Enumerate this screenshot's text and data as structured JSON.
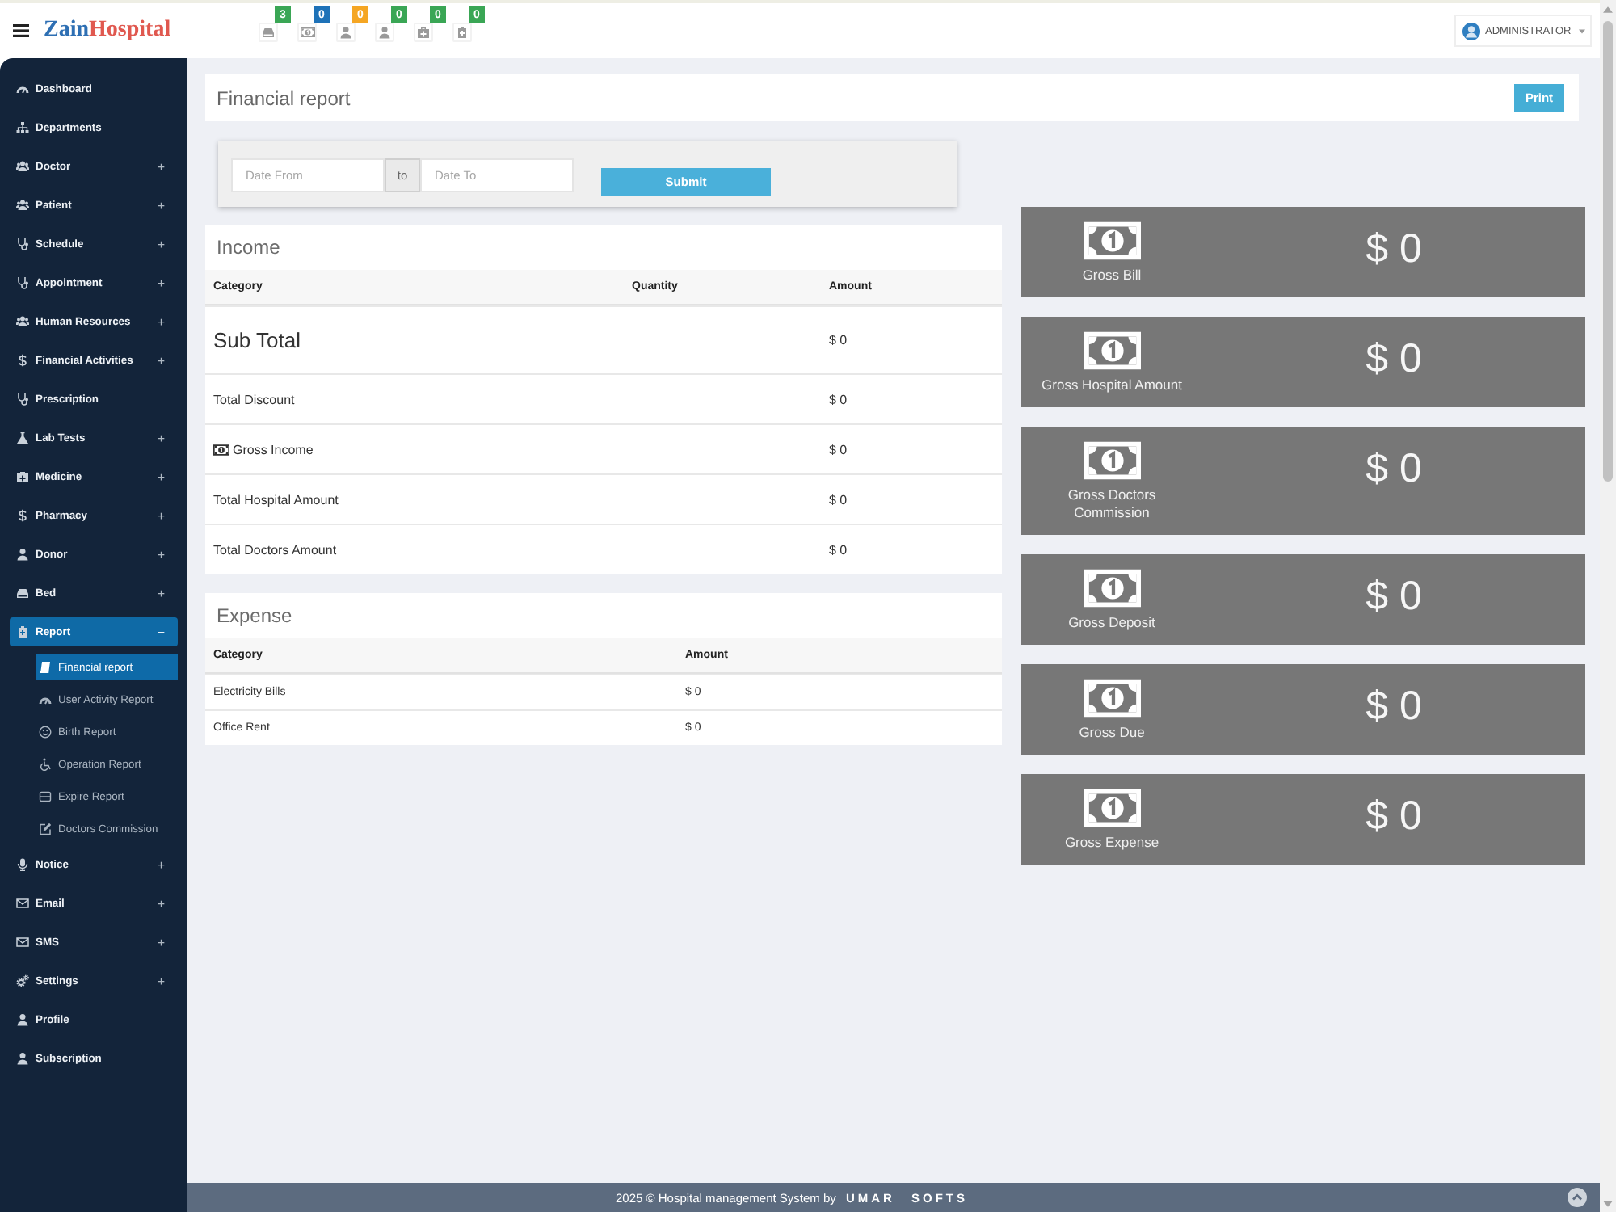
{
  "topbar": {
    "logo": {
      "first": "Zain",
      "second": "Hospital"
    },
    "notifications": [
      {
        "count": "3",
        "color": "#3aa655"
      },
      {
        "count": "0",
        "color": "#1e72b8"
      },
      {
        "count": "0",
        "color": "#f5a623"
      },
      {
        "count": "0",
        "color": "#3aa655"
      },
      {
        "count": "0",
        "color": "#3aa655"
      },
      {
        "count": "0",
        "color": "#3aa655"
      }
    ],
    "user_menu": {
      "label": "ADMINISTRATOR"
    }
  },
  "sidebar": {
    "items": [
      {
        "label": "Dashboard",
        "selected": false
      },
      {
        "label": "Departments",
        "selected": false
      },
      {
        "label": "Doctor",
        "toggle": "+",
        "selected": false
      },
      {
        "label": "Patient",
        "toggle": "+",
        "selected": false
      },
      {
        "label": "Schedule",
        "toggle": "+",
        "selected": false
      },
      {
        "label": "Appointment",
        "toggle": "+",
        "selected": false
      },
      {
        "label": "Human Resources",
        "toggle": "+",
        "selected": false
      },
      {
        "label": "Financial Activities",
        "toggle": "+",
        "selected": false
      },
      {
        "label": "Prescription",
        "selected": false
      },
      {
        "label": "Lab Tests",
        "toggle": "+",
        "selected": false
      },
      {
        "label": "Medicine",
        "toggle": "+",
        "selected": false
      },
      {
        "label": "Pharmacy",
        "toggle": "+",
        "selected": false
      },
      {
        "label": "Donor",
        "toggle": "+",
        "selected": false
      },
      {
        "label": "Bed",
        "toggle": "+",
        "selected": false
      },
      {
        "label": "Report",
        "toggle": "−",
        "selected": true,
        "expanded": true,
        "children": [
          {
            "label": "Financial report",
            "selected": true
          },
          {
            "label": "User Activity Report",
            "selected": false
          },
          {
            "label": "Birth Report",
            "selected": false
          },
          {
            "label": "Operation Report",
            "selected": false
          },
          {
            "label": "Expire Report",
            "selected": false
          },
          {
            "label": "Doctors Commission",
            "selected": false
          }
        ]
      },
      {
        "label": "Notice",
        "toggle": "+",
        "selected": false
      },
      {
        "label": "Email",
        "toggle": "+",
        "selected": false
      },
      {
        "label": "SMS",
        "toggle": "+",
        "selected": false
      },
      {
        "label": "Settings",
        "toggle": "+",
        "selected": false
      },
      {
        "label": "Profile",
        "selected": false
      },
      {
        "label": "Subscription",
        "selected": false
      }
    ]
  },
  "page_header": {
    "title": "Financial report",
    "print_button": "Print"
  },
  "filter": {
    "date_from": {
      "placeholder": "Date From"
    },
    "separator": "to",
    "date_to": {
      "placeholder": "Date To"
    },
    "submit": "Submit"
  },
  "income": {
    "title": "Income",
    "columns": [
      "Category",
      "Quantity",
      "Amount"
    ],
    "rows": [
      {
        "kind": "subtotal",
        "category": "Sub Total",
        "amount": "$ 0"
      },
      {
        "kind": "plain",
        "category": "Total Discount",
        "amount": "$ 0"
      },
      {
        "kind": "money",
        "category": "Gross Income",
        "amount": "$ 0"
      },
      {
        "kind": "plain",
        "category": "Total Hospital Amount",
        "amount": "$ 0"
      },
      {
        "kind": "plain",
        "category": "Total Doctors Amount",
        "amount": "$ 0"
      }
    ]
  },
  "expense": {
    "title": "Expense",
    "columns": [
      "Category",
      "Amount"
    ],
    "rows": [
      {
        "category": "Electricity Bills",
        "amount": "$ 0"
      },
      {
        "category": "Office Rent",
        "amount": "$ 0"
      }
    ]
  },
  "summary_cards": [
    {
      "label": "Gross Bill",
      "value": "$ 0"
    },
    {
      "label": "Gross Hospital Amount",
      "value": "$ 0"
    },
    {
      "label": "Gross Doctors Commission",
      "value": "$ 0"
    },
    {
      "label": "Gross Deposit",
      "value": "$ 0"
    },
    {
      "label": "Gross Due",
      "value": "$ 0"
    },
    {
      "label": "Gross Expense",
      "value": "$ 0"
    }
  ],
  "footer": {
    "text": "2025 © Hospital management System by",
    "brand": "UMAR SOFTS"
  }
}
